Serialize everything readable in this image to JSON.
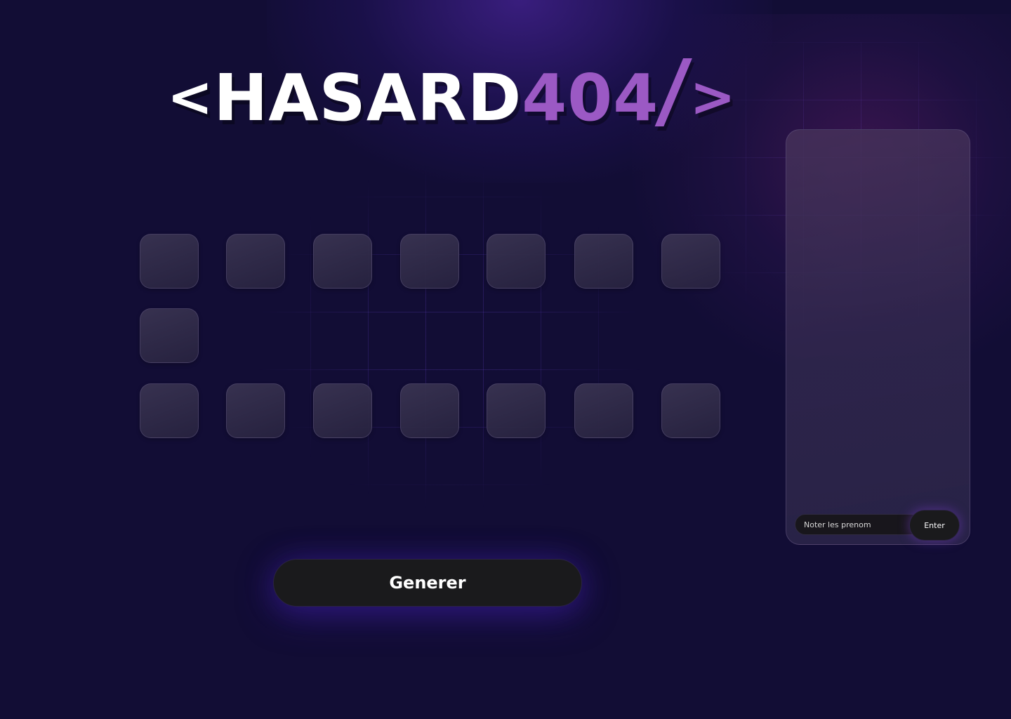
{
  "logo": {
    "open_bracket": "<",
    "word": "HASARD",
    "number": "404",
    "slash": "/",
    "close_bracket": ">"
  },
  "colors": {
    "background": "#120d35",
    "accent_purple": "#9b59c4",
    "button_dark": "#1a1a1c"
  },
  "slots": {
    "row1_count": 7,
    "row2_count": 1,
    "row3_count": 7
  },
  "generate_button": {
    "label": "Generer"
  },
  "name_panel": {
    "input_placeholder": "Noter les prenom",
    "input_value": "",
    "enter_label": "Enter"
  }
}
